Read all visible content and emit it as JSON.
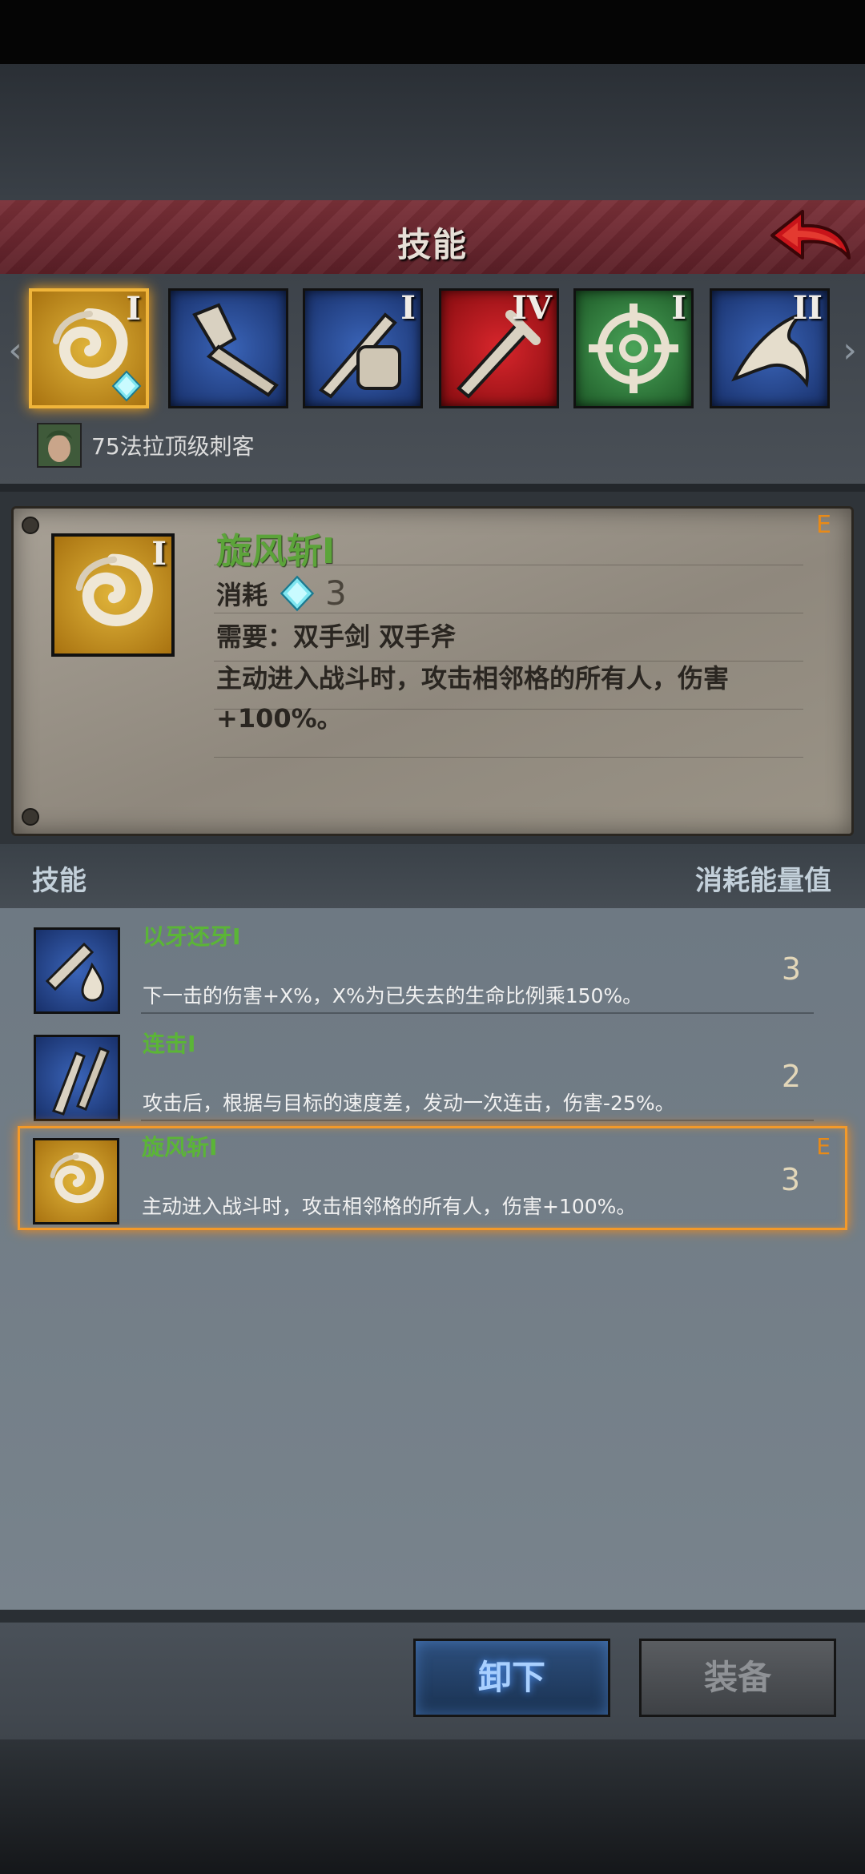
{
  "header": {
    "title": "技能"
  },
  "icon_row": [
    {
      "id": "whirlwind",
      "roman": "I",
      "selected": true,
      "bg": "#d29a1a",
      "gem_count": "3"
    },
    {
      "id": "tooth-for-tooth",
      "roman": "",
      "selected": false,
      "bg": "#22428a"
    },
    {
      "id": "combo",
      "roman": "I",
      "selected": false,
      "bg": "#22428a"
    },
    {
      "id": "sword-red",
      "roman": "IV",
      "selected": false,
      "bg": "#b3141a"
    },
    {
      "id": "target",
      "roman": "I",
      "selected": false,
      "bg": "#2f7a3a"
    },
    {
      "id": "bird",
      "roman": "II",
      "selected": false,
      "bg": "#22428a"
    }
  ],
  "owner": {
    "name": "75法拉顶级刺客"
  },
  "detail": {
    "name": "旋风斩I",
    "grade": "E",
    "roman": "I",
    "cost_label": "消耗",
    "cost_value": "3",
    "requirement": "需要：双手剑  双手斧",
    "description": "主动进入战斗时，攻击相邻格的所有人，伤害+100%。"
  },
  "list_header": {
    "left": "技能",
    "right": "消耗能量值"
  },
  "skills": [
    {
      "name": "以牙还牙I",
      "description": "下一击的伤害+X%，X%为已失去的生命比例乘150%。",
      "cost": "3",
      "grade": "",
      "icon": "tooth-for-tooth"
    },
    {
      "name": "连击I",
      "description": "攻击后，根据与目标的速度差，发动一次连击，伤害-25%。",
      "cost": "2",
      "grade": "",
      "icon": "combo"
    },
    {
      "name": "旋风斩I",
      "description": "主动进入战斗时，攻击相邻格的所有人，伤害+100%。",
      "cost": "3",
      "grade": "E",
      "icon": "whirlwind"
    }
  ],
  "buttons": {
    "unequip": "卸下",
    "equip": "装备"
  },
  "colors": {
    "accent_orange": "#f39a2a",
    "skill_green": "#5bb537",
    "header_red": "#6b2630"
  }
}
